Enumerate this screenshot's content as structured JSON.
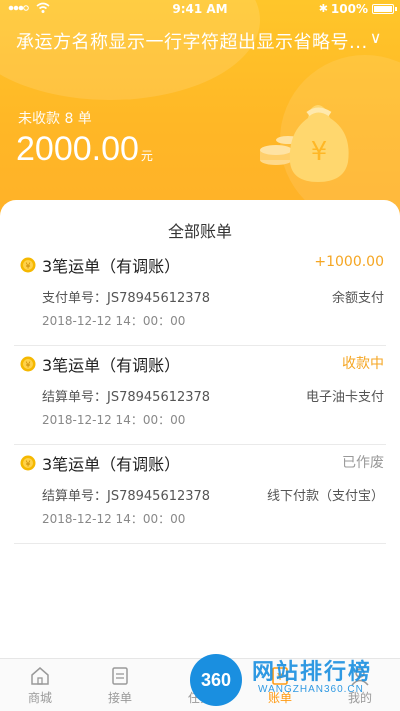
{
  "colors": {
    "accent": "#ff9a12",
    "header": "#ffb726",
    "income": "#f5a623",
    "receiving": "#f5a623",
    "voided": "#999999"
  },
  "status_bar": {
    "time": "9:41 AM",
    "battery": "100%"
  },
  "header": {
    "carrier_name": "承运方名称显示一行字符超出显示省略号...",
    "uncollected_label": "未收款 8 单",
    "amount": "2000.00",
    "amount_unit": "元"
  },
  "list": {
    "title": "全部账单",
    "bills": [
      {
        "title": "3笔运单（有调账）",
        "status": "+1000.00",
        "number": "支付单号：JS78945612378",
        "method": "余额支付",
        "time": "2018-12-12  14：00：00"
      },
      {
        "title": "3笔运单（有调账）",
        "status": "收款中",
        "number": "结算单号：JS78945612378",
        "method": "电子油卡支付",
        "time": "2018-12-12  14：00：00"
      },
      {
        "title": "3笔运单（有调账）",
        "status": "已作废",
        "number": "结算单号：JS78945612378",
        "method": "线下付款（支付宝）",
        "time": "2018-12-12  14：00：00"
      }
    ]
  },
  "tabbar": {
    "items": [
      {
        "label": "商城",
        "icon": "home-icon"
      },
      {
        "label": "接单",
        "icon": "order-icon"
      },
      {
        "label": "任务",
        "icon": "task-icon"
      },
      {
        "label": "账单",
        "icon": "bill-icon"
      },
      {
        "label": "我的",
        "icon": "profile-icon"
      }
    ]
  },
  "watermark": {
    "badge": "360",
    "name": "网站排行榜",
    "domain": "WANGZHAN360.CN"
  }
}
